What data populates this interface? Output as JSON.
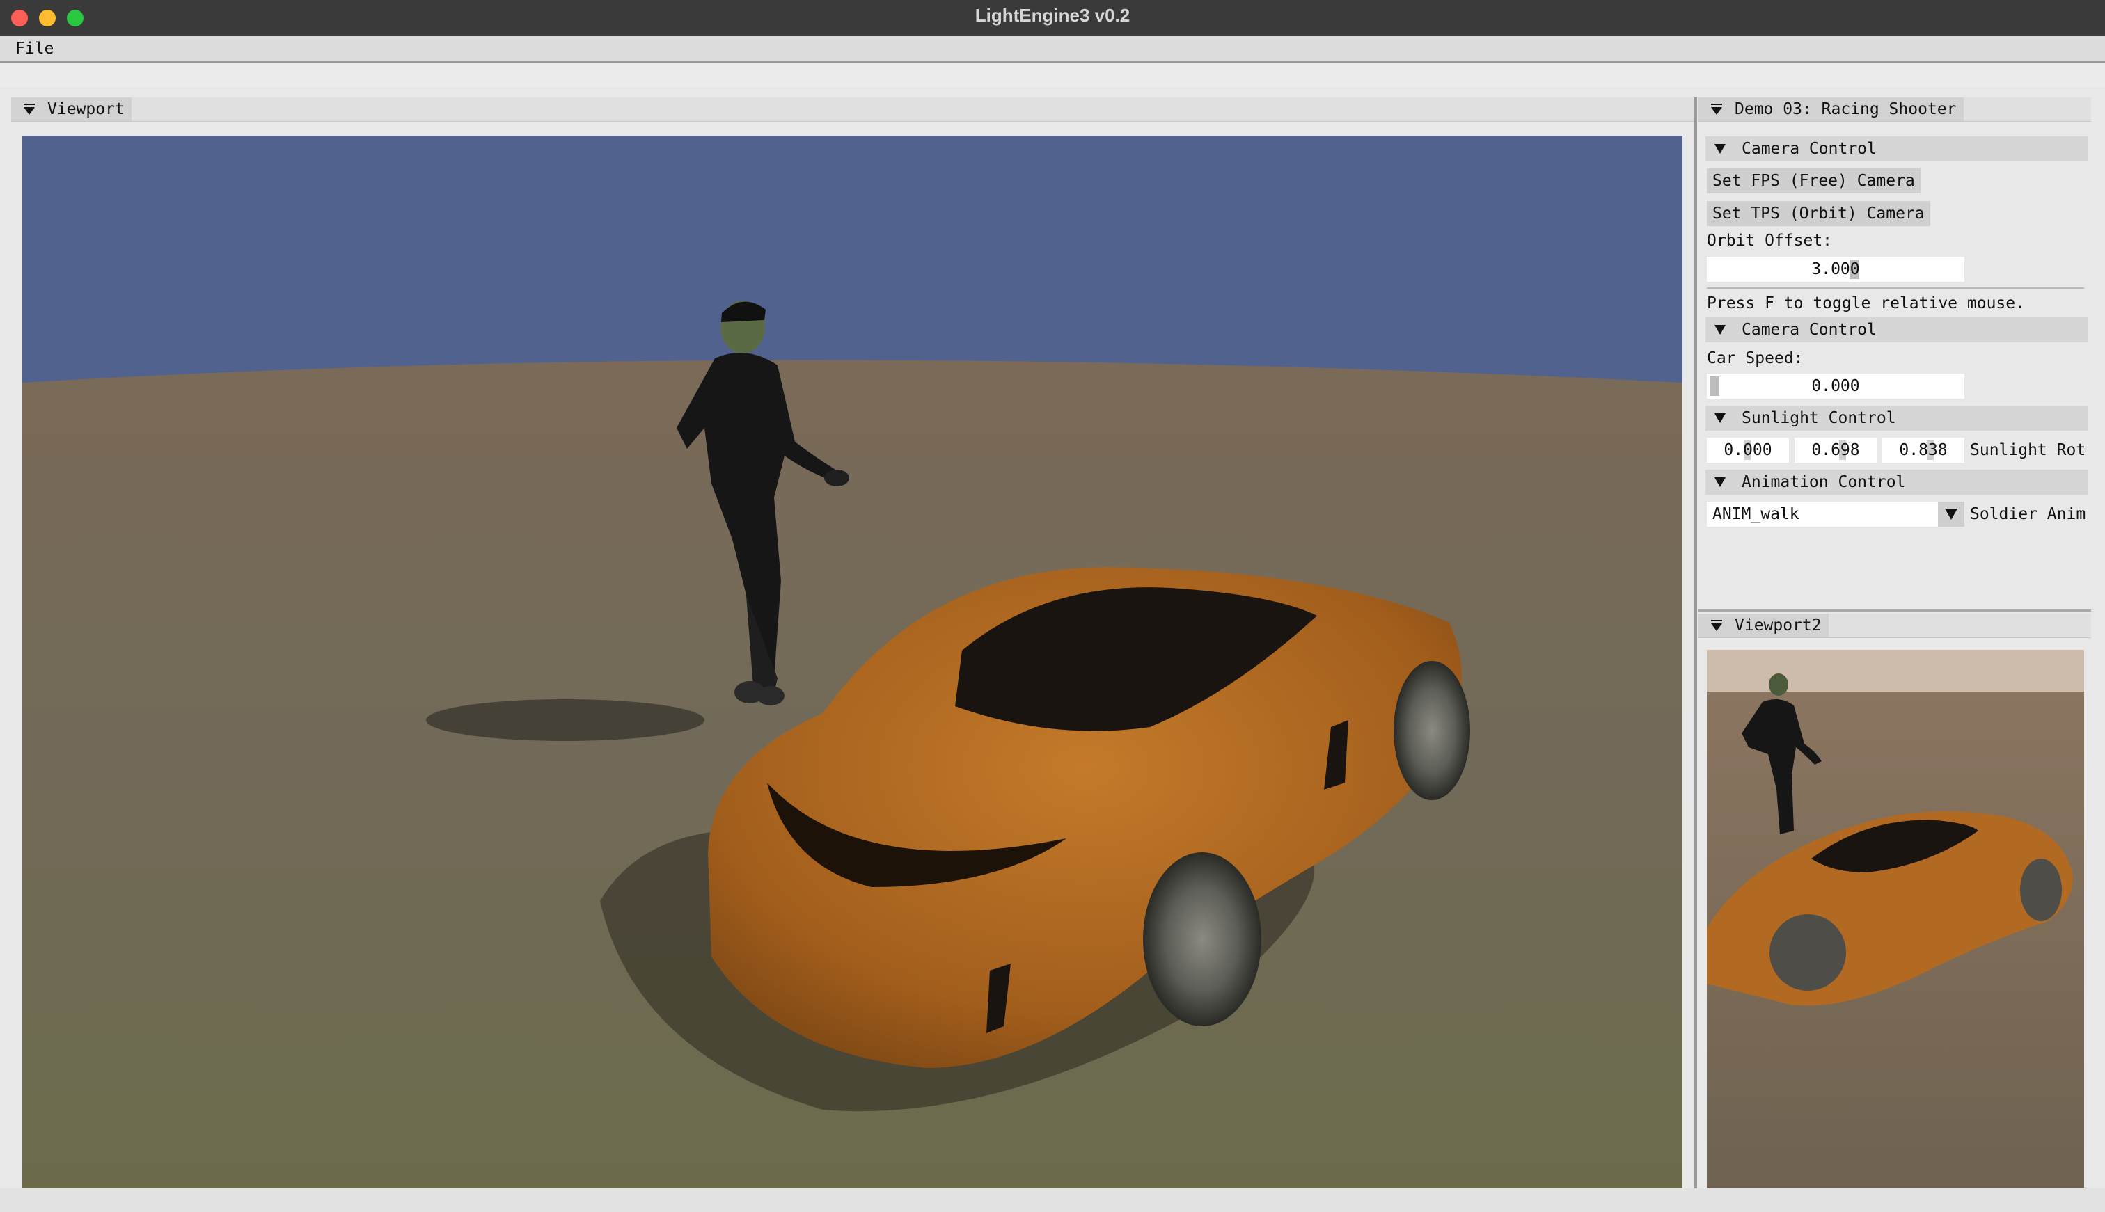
{
  "window": {
    "title": "LightEngine3 v0.2"
  },
  "menu": {
    "file": "File"
  },
  "viewport": {
    "title": "Viewport"
  },
  "viewport2": {
    "title": "Viewport2"
  },
  "panel": {
    "title": "Demo 03: Racing Shooter",
    "camera_control": {
      "header": "Camera Control",
      "fps_button": "Set FPS (Free) Camera",
      "tps_button": "Set TPS (Orbit) Camera",
      "orbit_offset_label": "Orbit Offset:",
      "orbit_offset_value": "3.000",
      "hint": "Press F to toggle relative mouse."
    },
    "car_control": {
      "header": "Camera Control",
      "car_speed_label": "Car Speed:",
      "car_speed_value": "0.000"
    },
    "sunlight_control": {
      "header": "Sunlight Control",
      "x": "0.000",
      "y": "0.698",
      "z": "0.838",
      "label": "Sunlight Rot"
    },
    "animation_control": {
      "header": "Animation Control",
      "selected": "ANIM_walk",
      "label": "Soldier Anim"
    }
  },
  "colors": {
    "sky": "#52628f",
    "ground": "#6f6a55",
    "car_body": "#b46a1f",
    "soldier": "#141414"
  },
  "icons": {
    "collapse": "triangle-down-icon",
    "dropdown": "chevron-down-icon"
  }
}
